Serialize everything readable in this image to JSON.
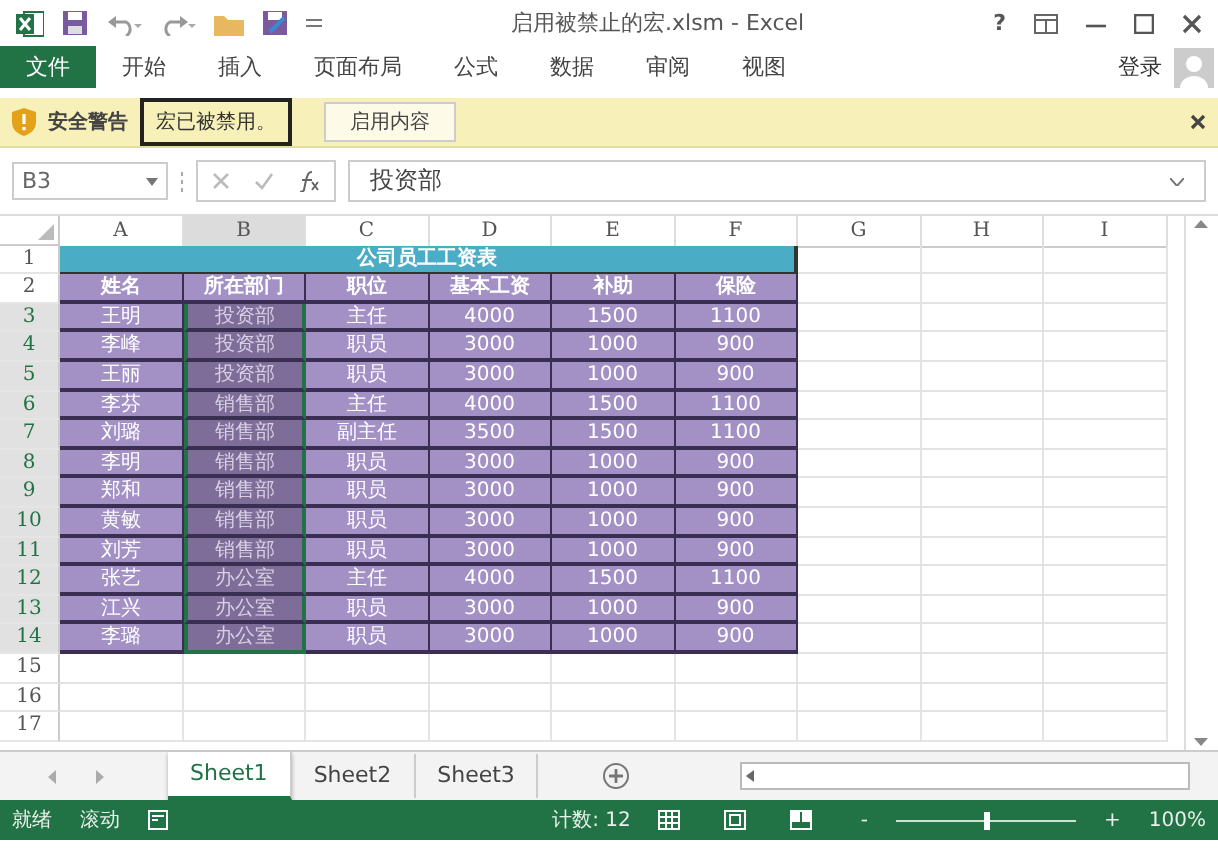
{
  "window": {
    "title": "启用被禁止的宏.xlsm - Excel",
    "help": "?"
  },
  "ribbon": {
    "tabs": [
      {
        "label": "文件",
        "kind": "file",
        "selected": false
      },
      {
        "label": "开始",
        "kind": "tab",
        "selected": false
      },
      {
        "label": "插入",
        "kind": "tab",
        "selected": false
      },
      {
        "label": "页面布局",
        "kind": "tab",
        "selected": false
      },
      {
        "label": "公式",
        "kind": "tab",
        "selected": false
      },
      {
        "label": "数据",
        "kind": "tab",
        "selected": false
      },
      {
        "label": "审阅",
        "kind": "tab",
        "selected": false
      },
      {
        "label": "视图",
        "kind": "tab",
        "selected": false
      }
    ],
    "sign_in": "登录"
  },
  "message_bar": {
    "title": "安全警告",
    "message": "宏已被禁用。",
    "button": "启用内容"
  },
  "formula_bar": {
    "name_box": "B3",
    "value": "投资部"
  },
  "sheet": {
    "columns": [
      {
        "label": "A",
        "selected": false
      },
      {
        "label": "B",
        "selected": true
      },
      {
        "label": "C",
        "selected": false
      },
      {
        "label": "D",
        "selected": false
      },
      {
        "label": "E",
        "selected": false
      },
      {
        "label": "F",
        "selected": false
      },
      {
        "label": "G",
        "selected": false
      },
      {
        "label": "H",
        "selected": false
      },
      {
        "label": "I",
        "selected": false
      }
    ],
    "row_numbers": [
      {
        "label": "1",
        "selected": false
      },
      {
        "label": "2",
        "selected": false
      },
      {
        "label": "3",
        "selected": true
      },
      {
        "label": "4",
        "selected": true
      },
      {
        "label": "5",
        "selected": true
      },
      {
        "label": "6",
        "selected": true
      },
      {
        "label": "7",
        "selected": true
      },
      {
        "label": "8",
        "selected": true
      },
      {
        "label": "9",
        "selected": true
      },
      {
        "label": "10",
        "selected": true
      },
      {
        "label": "11",
        "selected": true
      },
      {
        "label": "12",
        "selected": true
      },
      {
        "label": "13",
        "selected": true
      },
      {
        "label": "14",
        "selected": true
      },
      {
        "label": "15",
        "selected": false
      },
      {
        "label": "16",
        "selected": false
      },
      {
        "label": "17",
        "selected": false
      }
    ],
    "title": "公司员工工资表",
    "headers": [
      "姓名",
      "所在部门",
      "职位",
      "基本工资",
      "补助",
      "保险"
    ],
    "rows": [
      [
        "王明",
        "投资部",
        "主任",
        "4000",
        "1500",
        "1100"
      ],
      [
        "李峰",
        "投资部",
        "职员",
        "3000",
        "1000",
        "900"
      ],
      [
        "王丽",
        "投资部",
        "职员",
        "3000",
        "1000",
        "900"
      ],
      [
        "李芬",
        "销售部",
        "主任",
        "4000",
        "1500",
        "1100"
      ],
      [
        "刘璐",
        "销售部",
        "副主任",
        "3500",
        "1500",
        "1100"
      ],
      [
        "李明",
        "销售部",
        "职员",
        "3000",
        "1000",
        "900"
      ],
      [
        "郑和",
        "销售部",
        "职员",
        "3000",
        "1000",
        "900"
      ],
      [
        "黄敏",
        "销售部",
        "职员",
        "3000",
        "1000",
        "900"
      ],
      [
        "刘芳",
        "销售部",
        "职员",
        "3000",
        "1000",
        "900"
      ],
      [
        "张艺",
        "办公室",
        "主任",
        "4000",
        "1500",
        "1100"
      ],
      [
        "江兴",
        "办公室",
        "职员",
        "3000",
        "1000",
        "900"
      ],
      [
        "李璐",
        "办公室",
        "职员",
        "3000",
        "1000",
        "900"
      ]
    ]
  },
  "sheet_tabs": [
    {
      "label": "Sheet1",
      "selected": true
    },
    {
      "label": "Sheet2",
      "selected": false
    },
    {
      "label": "Sheet3",
      "selected": false
    }
  ],
  "status_bar": {
    "mode": "就绪",
    "scroll": "滚动",
    "count": "计数: 12",
    "zoom_out": "-",
    "zoom_in": "+",
    "zoom": {
      "level": 0.5
    },
    "zoom_label": "100%"
  }
}
